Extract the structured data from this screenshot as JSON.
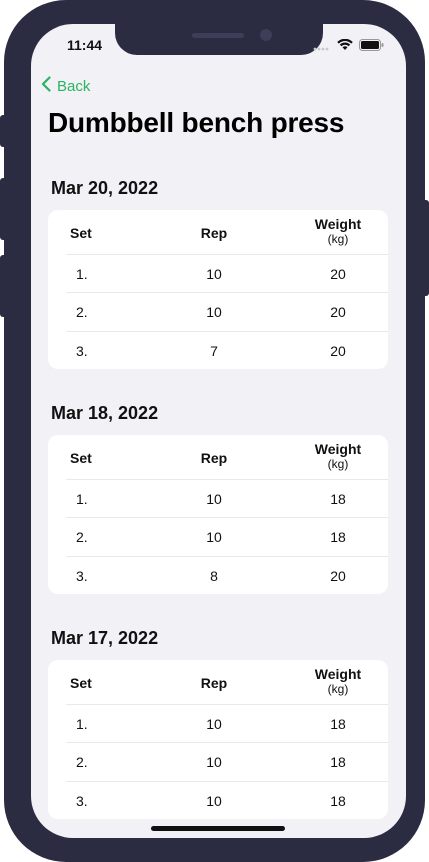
{
  "status_bar": {
    "time": "11:44"
  },
  "nav": {
    "back_label": "Back"
  },
  "page": {
    "title": "Dumbbell bench press"
  },
  "table_headers": {
    "set": "Set",
    "rep": "Rep",
    "weight": "Weight",
    "weight_unit": "(kg)"
  },
  "sessions": [
    {
      "date": "Mar 20, 2022",
      "sets": [
        {
          "set": "1.",
          "rep": "10",
          "weight": "20"
        },
        {
          "set": "2.",
          "rep": "10",
          "weight": "20"
        },
        {
          "set": "3.",
          "rep": "7",
          "weight": "20"
        }
      ]
    },
    {
      "date": "Mar 18, 2022",
      "sets": [
        {
          "set": "1.",
          "rep": "10",
          "weight": "18"
        },
        {
          "set": "2.",
          "rep": "10",
          "weight": "18"
        },
        {
          "set": "3.",
          "rep": "8",
          "weight": "20"
        }
      ]
    },
    {
      "date": "Mar 17, 2022",
      "sets": [
        {
          "set": "1.",
          "rep": "10",
          "weight": "18"
        },
        {
          "set": "2.",
          "rep": "10",
          "weight": "18"
        },
        {
          "set": "3.",
          "rep": "10",
          "weight": "18"
        }
      ]
    }
  ],
  "colors": {
    "accent": "#28b463",
    "frame": "#2b2c42",
    "background": "#f2f1f6"
  }
}
